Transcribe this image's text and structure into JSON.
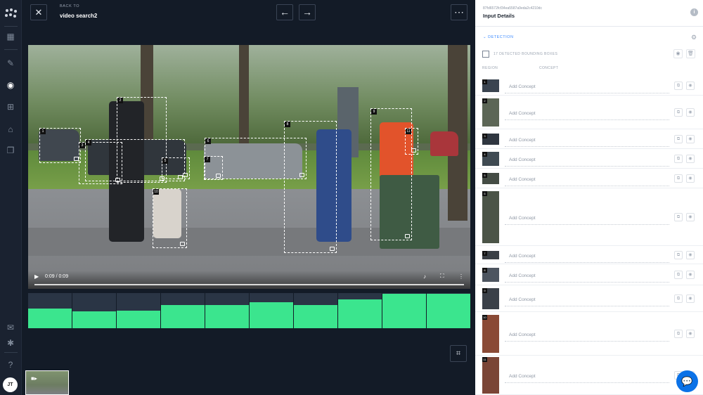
{
  "topbar": {
    "back_label": "BACK TO",
    "back_title": "video search2",
    "prev_icon": "arrow-left-icon",
    "next_icon": "arrow-right-icon",
    "more_icon": "more-icon"
  },
  "video": {
    "time": "0:09 / 0:09",
    "progress": 1.0,
    "boxes": [
      "1",
      "2",
      "3",
      "4",
      "5",
      "6",
      "7",
      "8",
      "9",
      "10",
      "11"
    ]
  },
  "timeline": {
    "levels": [
      0.56,
      0.48,
      0.5,
      0.66,
      0.66,
      0.74,
      0.66,
      0.82,
      0.98,
      0.98
    ]
  },
  "panel": {
    "input_id": "87fd6572fcf34ea5587a9eda2c4210dc",
    "title": "Input Details",
    "section": "DETECTION",
    "bb_label": "17 DETECTED BOUNDING BOXES",
    "col_region": "REGION",
    "col_concept": "CONCEPT",
    "placeholder": "Add Concept",
    "rows": [
      {
        "num": "1"
      },
      {
        "num": "2"
      },
      {
        "num": "3"
      },
      {
        "num": "4"
      },
      {
        "num": "5"
      },
      {
        "num": "6"
      },
      {
        "num": "7"
      },
      {
        "num": "8"
      },
      {
        "num": "9"
      },
      {
        "num": "10"
      },
      {
        "num": "11"
      }
    ]
  },
  "user": {
    "initials": "JT"
  },
  "colors": {
    "accent": "#3be58e",
    "link": "#3d8bff",
    "chat": "#0b72e7"
  }
}
